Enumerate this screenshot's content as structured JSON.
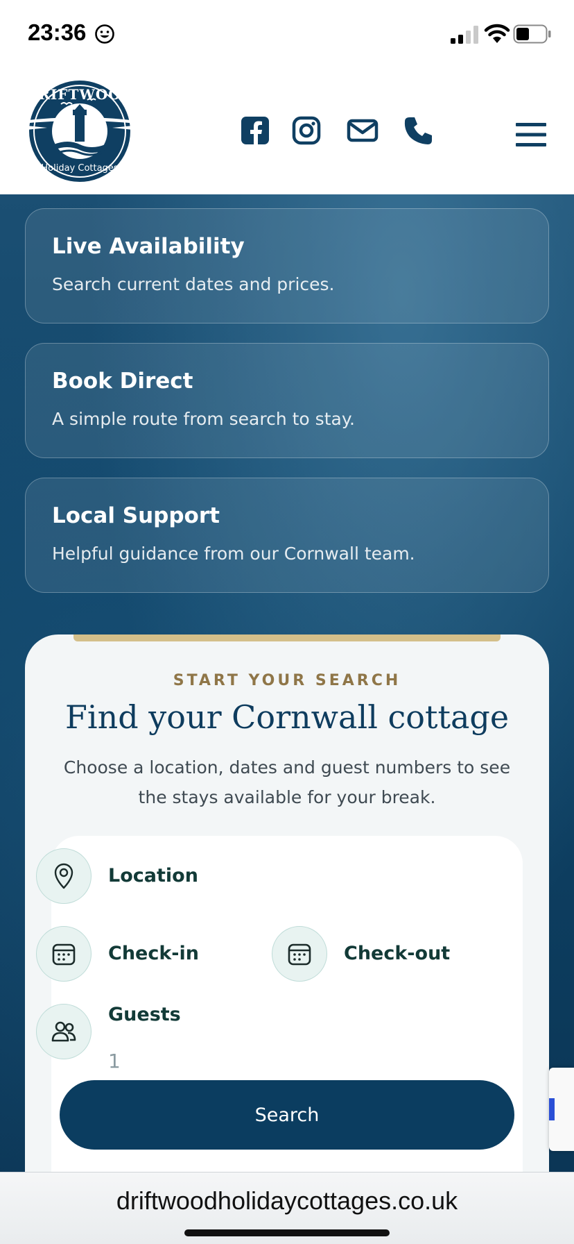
{
  "status_bar": {
    "time": "23:36",
    "icons": [
      "smiley-icon",
      "cellular-signal-icon",
      "wifi-icon",
      "battery-icon"
    ]
  },
  "header": {
    "logo": {
      "alt": "Driftwood Holiday Cottages",
      "top_text": "DRIFTWOOD",
      "bottom_text": "Holiday Cottages"
    },
    "icons": [
      "facebook-icon",
      "instagram-icon",
      "mail-icon",
      "phone-icon",
      "hamburger-menu-icon"
    ]
  },
  "feature_cards": [
    {
      "title": "Live Availability",
      "description": "Search current dates and prices."
    },
    {
      "title": "Book Direct",
      "description": "A simple route from search to stay."
    },
    {
      "title": "Local Support",
      "description": "Helpful guidance from our Cornwall team."
    }
  ],
  "search_panel": {
    "eyebrow": "START YOUR SEARCH",
    "title": "Find your Cornwall cottage",
    "description": "Choose a location, dates and guest numbers to see the stays available for your break.",
    "fields": {
      "location": {
        "label": "Location",
        "icon": "map-pin-icon"
      },
      "checkin": {
        "label": "Check-in",
        "icon": "calendar-icon"
      },
      "checkout": {
        "label": "Check-out",
        "icon": "calendar-icon"
      },
      "guests": {
        "label": "Guests",
        "value": "1",
        "icon": "guests-icon"
      }
    },
    "search_button": "Search"
  },
  "browser": {
    "url": "driftwoodholidaycottages.co.uk"
  },
  "colors": {
    "brand_navy": "#0b3d60",
    "gold_accent": "#8f7648",
    "gold_bar": "#d4bf8a",
    "field_text": "#123a37"
  }
}
